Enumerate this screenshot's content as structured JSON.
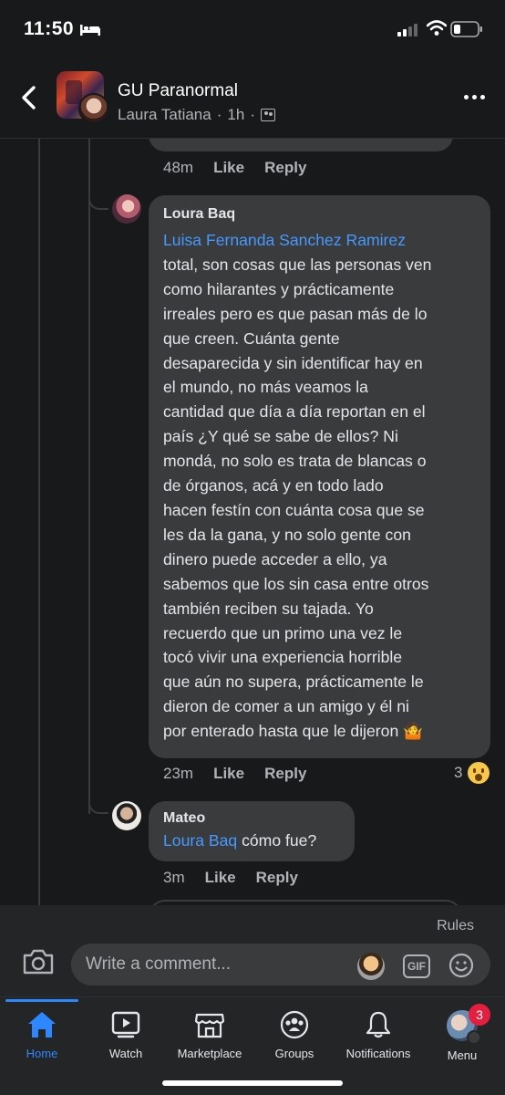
{
  "status_bar": {
    "time": "11:50"
  },
  "header": {
    "group_name": "GU Paranormal",
    "author": "Laura Tatiana",
    "separator": "·",
    "time_ago": "1h"
  },
  "comments": [
    {
      "time": "48m",
      "like_label": "Like",
      "reply_label": "Reply"
    },
    {
      "name": "Loura Baq",
      "mention": "Luisa Fernanda Sanchez Ramirez",
      "lines": [
        "total, son cosas que las personas ven",
        "como hilarantes y prácticamente",
        "irreales pero es que pasan más de lo",
        "que creen. Cuánta gente",
        "desaparecida y sin identificar hay en",
        "el mundo, no más veamos la",
        "cantidad que día a día reportan en el",
        "país ¿Y qué se sabe de ellos? Ni",
        "mondá, no solo es trata de blancas o",
        "de órganos, acá y en todo lado",
        "hacen festín con cuánta cosa que se",
        "les da la gana, y no solo gente con",
        "dinero puede acceder a ello, ya",
        "sabemos que los sin casa entre otros",
        "también reciben su tajada. Yo",
        "recuerdo que un primo una vez le",
        "tocó vivir una experiencia horrible",
        "que aún no supera, prácticamente le",
        "dieron de comer a un amigo y él ni",
        "por enterado hasta que le dijeron 🤷"
      ],
      "time": "23m",
      "like_label": "Like",
      "reply_label": "Reply",
      "reaction_count": "3"
    },
    {
      "name": "Mateo",
      "mention": "Loura Baq",
      "text": " cómo fue?",
      "time": "3m",
      "like_label": "Like",
      "reply_label": "Reply"
    }
  ],
  "composer": {
    "rules_label": "Rules",
    "placeholder": "Write a comment...",
    "gif_label": "GIF"
  },
  "tabs": [
    {
      "label": "Home",
      "icon": "home-icon",
      "active": true
    },
    {
      "label": "Watch",
      "icon": "watch-icon"
    },
    {
      "label": "Marketplace",
      "icon": "marketplace-icon"
    },
    {
      "label": "Groups",
      "icon": "groups-icon"
    },
    {
      "label": "Notifications",
      "icon": "bell-icon"
    },
    {
      "label": "Menu",
      "icon": "profile-avatar"
    }
  ],
  "menu_badge": "3",
  "colors": {
    "accent": "#2d88ff",
    "mention": "#4599ff",
    "bubble": "#3a3b3c",
    "background": "#18191a",
    "badge": "#e41e3f"
  }
}
